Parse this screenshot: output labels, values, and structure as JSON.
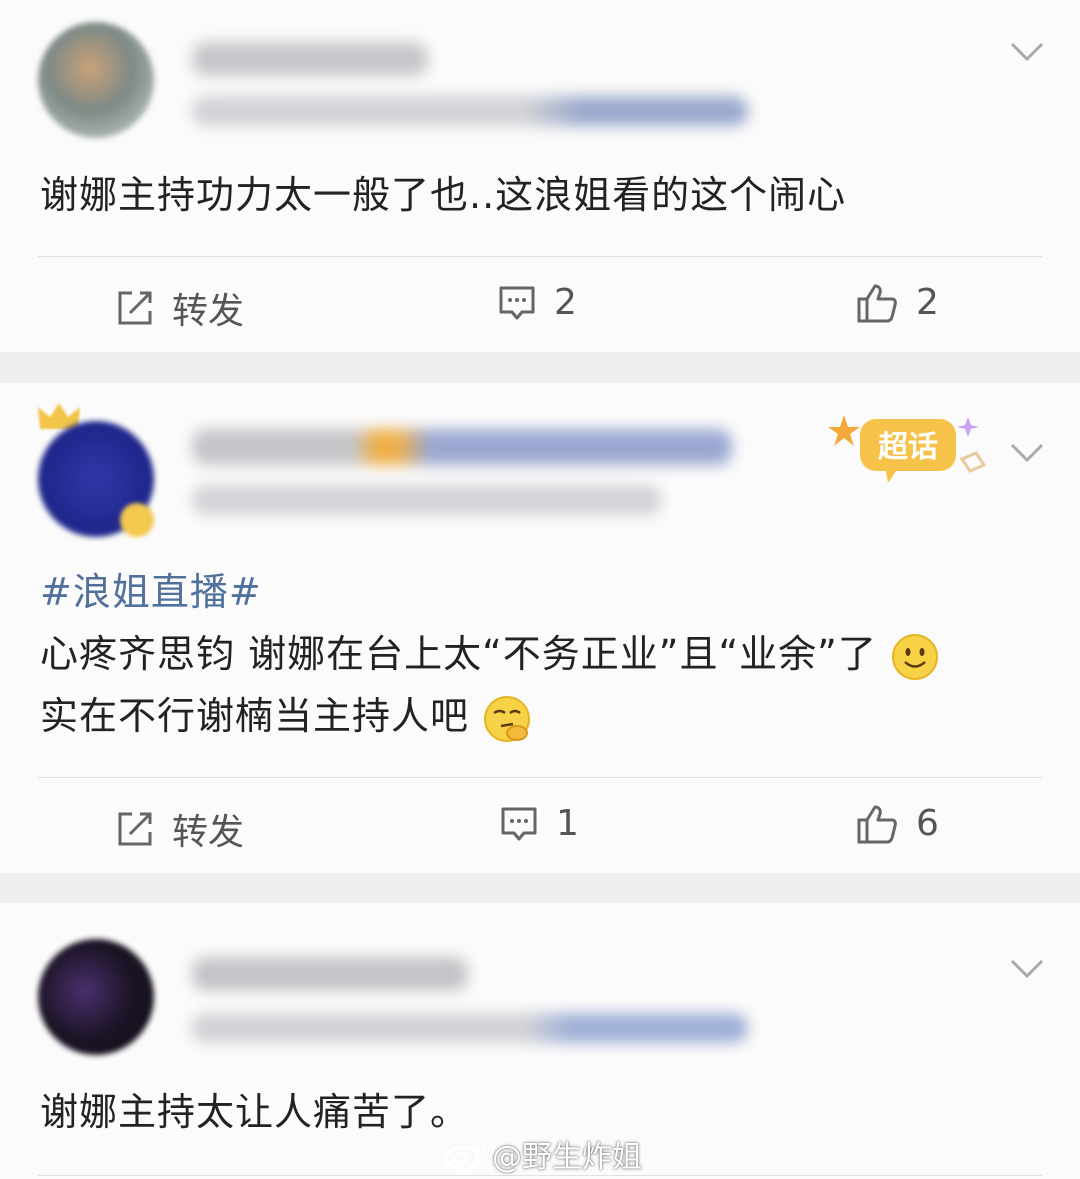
{
  "comments": [
    {
      "text": "谢娜主持功力太一般了也..这浪姐看的这个闹心",
      "repost_label": "转发",
      "comment_count": "2",
      "like_count": "2"
    },
    {
      "topic": "#浪姐直播#",
      "line1": "心疼齐思钧 谢娜在台上太“不务正业”且“业余”了",
      "line2": "实在不行谢楠当主持人吧",
      "badge": "超话",
      "repost_label": "转发",
      "comment_count": "1",
      "like_count": "6"
    },
    {
      "text": "谢娜主持太让人痛苦了。"
    }
  ],
  "watermark": "@野生炸姐",
  "colors": {
    "topic": "#52709c",
    "badge": "#f5b83a",
    "separator": "#efeff1"
  }
}
